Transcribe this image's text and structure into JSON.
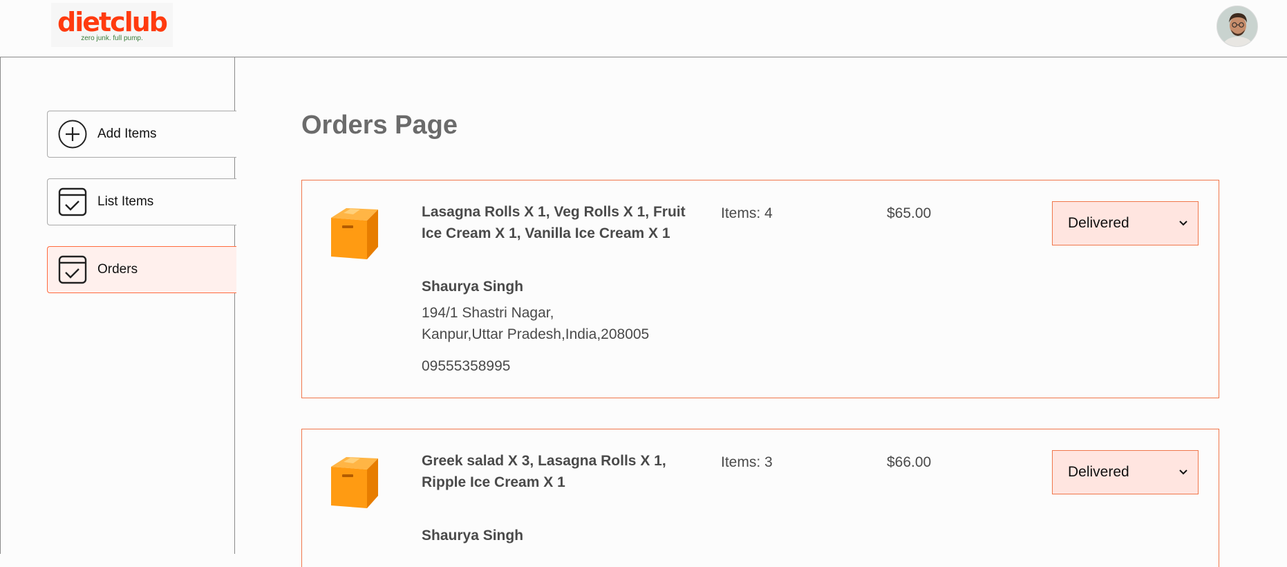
{
  "brand": {
    "logo_text": "dietclub",
    "tagline": "zero junk. full pump."
  },
  "sidebar": {
    "items": [
      {
        "label": "Add Items",
        "icon": "add-circle-icon"
      },
      {
        "label": "List Items",
        "icon": "calendar-check-icon"
      },
      {
        "label": "Orders",
        "icon": "calendar-check-icon",
        "active": true
      }
    ]
  },
  "main": {
    "title": "Orders Page"
  },
  "orders": [
    {
      "items": "Lasagna Rolls X 1, Veg Rolls X 1, Fruit Ice Cream X 1, Vanilla Ice Cream X 1",
      "customer": "Shaurya Singh",
      "address_line1": "194/1 Shastri Nagar,",
      "address_line2": "Kanpur,Uttar Pradesh,India,208005",
      "phone": "09555358995",
      "count": "Items: 4",
      "amount": "$65.00",
      "status": "Delivered"
    },
    {
      "items": "Greek salad X 3, Lasagna Rolls X 1, Ripple Ice Cream X 1",
      "customer": "Shaurya Singh",
      "count": "Items: 3",
      "amount": "$66.00",
      "status": "Delivered"
    }
  ],
  "colors": {
    "brand": "#ff3b0f",
    "accent_border": "#f0764a",
    "active_bg": "#fff0ed",
    "select_bg": "#ffe5e0"
  }
}
